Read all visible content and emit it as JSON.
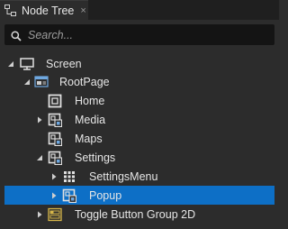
{
  "panel": {
    "tab_label": "Node Tree",
    "close_glyph": "×",
    "search_placeholder": "Search...",
    "colors": {
      "background": "#2c2c2c",
      "tab_bar": "#1f1f1f",
      "search_bg": "#141414",
      "selection": "#0d6fc6",
      "text": "#e6e6e6",
      "placeholder": "#9c9c9c"
    }
  },
  "tree": [
    {
      "label": "Screen",
      "icon": "monitor-icon",
      "arrow": "expanded"
    },
    {
      "label": "RootPage",
      "icon": "page-icon",
      "arrow": "expanded"
    },
    {
      "label": "Home",
      "icon": "node-icon",
      "arrow": "none"
    },
    {
      "label": "Media",
      "icon": "component-node-icon",
      "arrow": "collapsed"
    },
    {
      "label": "Maps",
      "icon": "component-node-icon",
      "arrow": "none"
    },
    {
      "label": "Settings",
      "icon": "component-node-icon",
      "arrow": "expanded"
    },
    {
      "label": "SettingsMenu",
      "icon": "grid-icon",
      "arrow": "collapsed"
    },
    {
      "label": "Popup",
      "icon": "component-node-icon",
      "arrow": "collapsed",
      "selected": true
    },
    {
      "label": "Toggle Button Group 2D",
      "icon": "toggle-group-icon",
      "arrow": "collapsed"
    }
  ]
}
